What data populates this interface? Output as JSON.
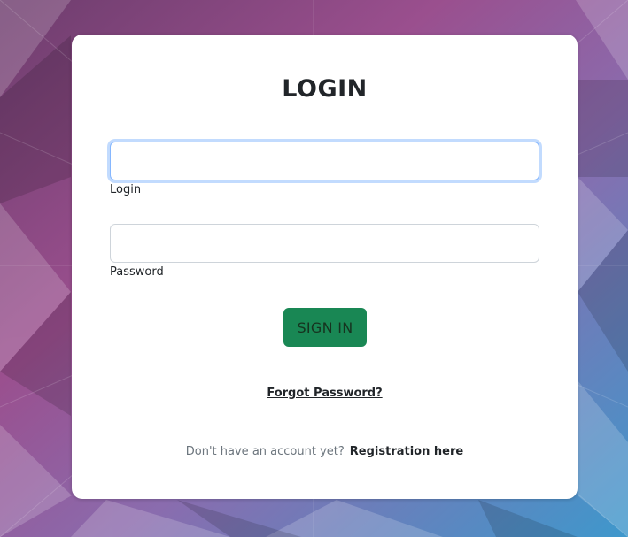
{
  "login_form": {
    "title": "LOGIN",
    "login_field": {
      "value": "",
      "placeholder": "",
      "label": "Login"
    },
    "password_field": {
      "value": "",
      "placeholder": "",
      "label": "Password"
    },
    "sign_in_label": "SIGN IN",
    "forgot_password_label": "Forgot Password?",
    "register_prompt": "Don't have an account yet?",
    "register_link_label": "Registration here"
  },
  "colors": {
    "sign_in_button": "#198754",
    "focus_ring": "#86b7fe",
    "card_background": "#ffffff"
  }
}
